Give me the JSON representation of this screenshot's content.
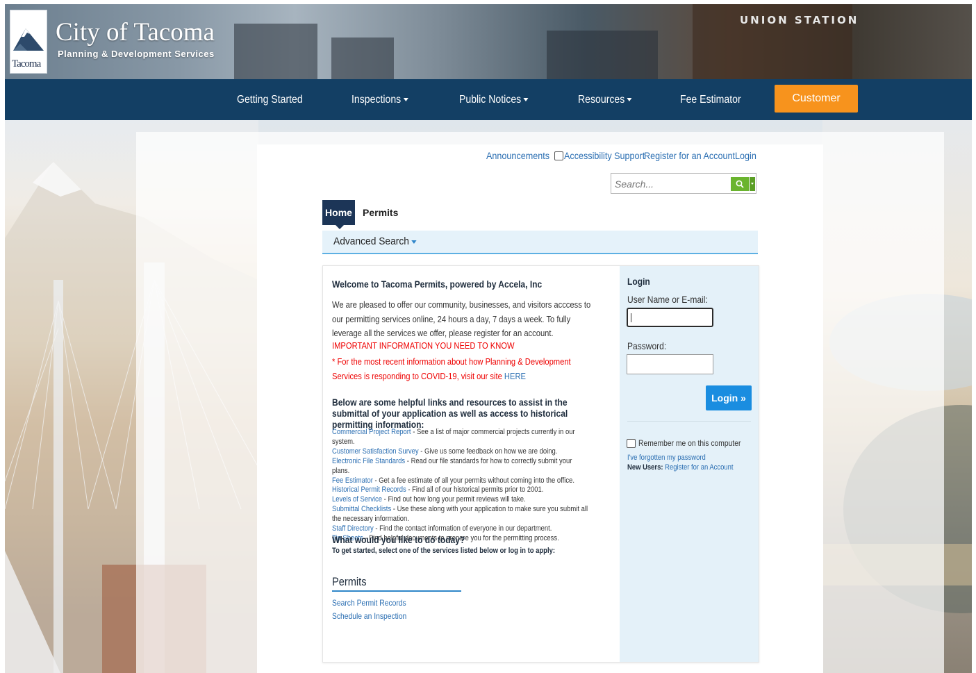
{
  "header": {
    "logo_text": "Tacoma",
    "title": "City of Tacoma",
    "subtitle": "Planning & Development Services",
    "sign_text": "UNION STATION"
  },
  "nav": {
    "items": [
      {
        "label": "Getting Started"
      },
      {
        "label": "Inspections"
      },
      {
        "label": "Public Notices"
      },
      {
        "label": "Resources"
      },
      {
        "label": "Fee Estimator"
      }
    ],
    "survey_label": "Customer Survey"
  },
  "toplinks": {
    "announcements": "Announcements",
    "accessibility": "Accessibility Support",
    "register": "Register for an Account",
    "login": "Login"
  },
  "search": {
    "placeholder": "Search..."
  },
  "tabs": {
    "home": "Home",
    "permits": "Permits"
  },
  "advanced_search": "Advanced Search",
  "welcome": {
    "title": "Welcome to Tacoma Permits, powered by Accela, Inc",
    "body": "We are pleased to offer our community, businesses, and visitors acccess to our permitting services online, 24 hours a day, 7 days a week. To fully leverage all the services we offer, please register for an account.",
    "important": "IMPORTANT INFORMATION YOU NEED TO KNOW",
    "covid": "* For the most recent information about how Planning & Development Services is responding to COVID-19, visit our site",
    "covid_link": "HERE",
    "helpful_title": "Below are some helpful links and resources to assist in the submittal of your application as well as access to historical permitting information:",
    "links": [
      {
        "label": "Commercial Project Report",
        "desc": " - See a list of major commercial projects currently in our system."
      },
      {
        "label": "Customer Satisfaction Survey",
        "desc": " - Give us some feedback on how we are doing."
      },
      {
        "label": "Electronic File Standards",
        "desc": " - Read our file standards for how to correctly submit your plans."
      },
      {
        "label": "Fee Estimator",
        "desc": " - Get a fee estimate of all your permits without coming into the office."
      },
      {
        "label": "Historical Permit Records",
        "desc": " - Find all of our historical permits prior to 2001."
      },
      {
        "label": "Levels of Service",
        "desc": " - Find out how long your permit reviews will take."
      },
      {
        "label": "Submittal Checklists",
        "desc": " - Use these along with your application to make sure you submit all the necessary information."
      },
      {
        "label": "Staff Directory",
        "desc": " - Find the contact information of everyone in our department."
      },
      {
        "label": "Tip Sheets",
        "desc": " - Find helpful documents to prepare you for the permitting process."
      }
    ],
    "today_title": "What would you like to do today?",
    "today_sub": "To get started, select one of the services listed below or log in to apply:",
    "permits_heading": "Permits",
    "permit_links": [
      "Search Permit Records",
      "Schedule an Inspection"
    ]
  },
  "login": {
    "heading": "Login",
    "user_label": "User Name or E-mail:",
    "password_label": "Password:",
    "button": "Login »",
    "remember": "Remember me on this computer",
    "forgot": "I've forgotten my password",
    "new_users_label": "New Users:",
    "new_users_link": "Register for an Account"
  },
  "colors": {
    "navbar": "#133f64",
    "survey_button": "#f7931d",
    "login_button": "#1a8de0",
    "link": "#2a6eb2",
    "alert": "#ee0000"
  }
}
